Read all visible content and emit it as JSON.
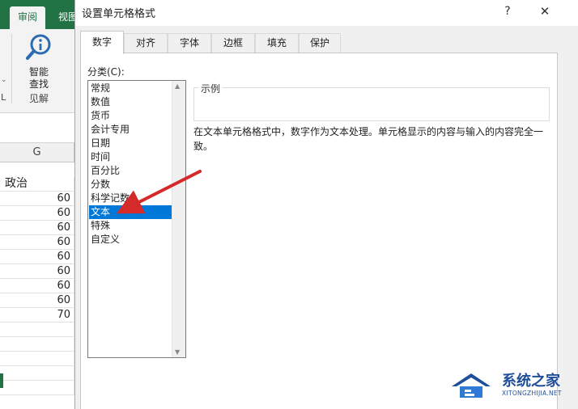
{
  "excel": {
    "ribbon_tabs": [
      "审阅",
      "视图"
    ],
    "lookup_label_line1": "智能",
    "lookup_label_line2": "查找",
    "group_label": "见解",
    "column_header": "G",
    "column_title": "政治",
    "values": [
      "60",
      "60",
      "60",
      "60",
      "60",
      "60",
      "60",
      "60",
      "70"
    ],
    "accent_color": "#217346"
  },
  "dialog": {
    "title": "设置单元格格式",
    "help_label": "?",
    "close_label": "✕",
    "tabs": [
      "数字",
      "对齐",
      "字体",
      "边框",
      "填充",
      "保护"
    ],
    "active_tab": "数字",
    "category_label": "分类(C):",
    "categories": [
      "常规",
      "数值",
      "货币",
      "会计专用",
      "日期",
      "时间",
      "百分比",
      "分数",
      "科学记数",
      "文本",
      "特殊",
      "自定义"
    ],
    "selected_category": "文本",
    "sample_label": "示例",
    "description": "在文本单元格格式中，数字作为文本处理。单元格显示的内容与输入的内容完全一致。",
    "selection_color": "#0078d7"
  },
  "annotation": {
    "arrow_color": "#d42a2a",
    "points_to": "文本"
  },
  "watermark": {
    "main": "系统之家",
    "sub": "XITONGZHIJIA.NET",
    "color": "#1f4e9a"
  }
}
